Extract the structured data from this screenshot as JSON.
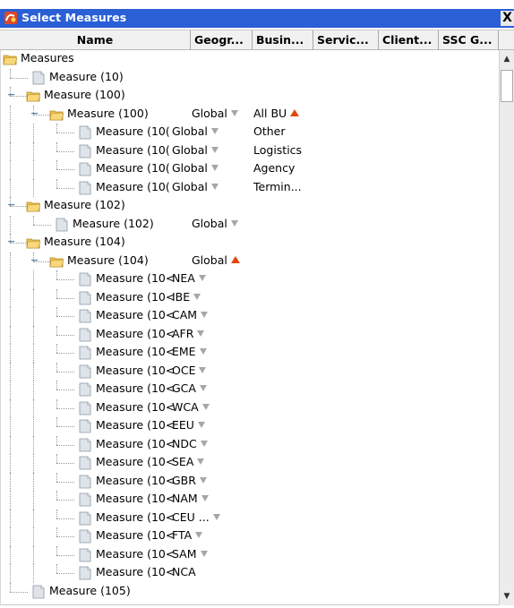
{
  "window": {
    "title": "Select Measures",
    "close_label": "X"
  },
  "columns": [
    "Name",
    "Geogr...",
    "Busin...",
    "Servic...",
    "Client...",
    "SSC G..."
  ],
  "rows": [
    {
      "level": 0,
      "type": "folder",
      "expanded": true,
      "label": "Measures",
      "geo": "",
      "geo_arrow": "",
      "bu": "",
      "bu_arrow": ""
    },
    {
      "level": 1,
      "type": "file",
      "expanded": false,
      "label": "Measure (10)",
      "geo": "",
      "geo_arrow": "",
      "bu": "",
      "bu_arrow": ""
    },
    {
      "level": 1,
      "type": "folder",
      "expanded": true,
      "label": "Measure (100)",
      "geo": "",
      "geo_arrow": "",
      "bu": "",
      "bu_arrow": ""
    },
    {
      "level": 2,
      "type": "folder",
      "expanded": true,
      "label": "Measure (100)",
      "geo": "Global",
      "geo_arrow": "down",
      "bu": "All BU",
      "bu_arrow": "up"
    },
    {
      "level": 3,
      "type": "file",
      "expanded": false,
      "label": "Measure (10(",
      "geo": "Global",
      "geo_arrow": "down",
      "bu": "Other",
      "bu_arrow": ""
    },
    {
      "level": 3,
      "type": "file",
      "expanded": false,
      "label": "Measure (10(",
      "geo": "Global",
      "geo_arrow": "down",
      "bu": "Logistics",
      "bu_arrow": ""
    },
    {
      "level": 3,
      "type": "file",
      "expanded": false,
      "label": "Measure (10(",
      "geo": "Global",
      "geo_arrow": "down",
      "bu": "Agency",
      "bu_arrow": ""
    },
    {
      "level": 3,
      "type": "file",
      "expanded": false,
      "label": "Measure (10(",
      "geo": "Global",
      "geo_arrow": "down",
      "bu": "Termin...",
      "bu_arrow": ""
    },
    {
      "level": 1,
      "type": "folder",
      "expanded": true,
      "label": "Measure (102)",
      "geo": "",
      "geo_arrow": "",
      "bu": "",
      "bu_arrow": ""
    },
    {
      "level": 2,
      "type": "file",
      "expanded": false,
      "label": "Measure (102)",
      "geo": "Global",
      "geo_arrow": "down",
      "bu": "",
      "bu_arrow": ""
    },
    {
      "level": 1,
      "type": "folder",
      "expanded": true,
      "label": "Measure (104)",
      "geo": "",
      "geo_arrow": "",
      "bu": "",
      "bu_arrow": ""
    },
    {
      "level": 2,
      "type": "folder",
      "expanded": true,
      "label": "Measure (104)",
      "geo": "Global",
      "geo_arrow": "up",
      "bu": "",
      "bu_arrow": ""
    },
    {
      "level": 3,
      "type": "file",
      "expanded": false,
      "label": "Measure (10<",
      "geo": "NEA",
      "geo_arrow": "down",
      "bu": "",
      "bu_arrow": ""
    },
    {
      "level": 3,
      "type": "file",
      "expanded": false,
      "label": "Measure (10<",
      "geo": "IBE",
      "geo_arrow": "down",
      "bu": "",
      "bu_arrow": ""
    },
    {
      "level": 3,
      "type": "file",
      "expanded": false,
      "label": "Measure (10<",
      "geo": "CAM",
      "geo_arrow": "down",
      "bu": "",
      "bu_arrow": ""
    },
    {
      "level": 3,
      "type": "file",
      "expanded": false,
      "label": "Measure (10<",
      "geo": "AFR",
      "geo_arrow": "down",
      "bu": "",
      "bu_arrow": ""
    },
    {
      "level": 3,
      "type": "file",
      "expanded": false,
      "label": "Measure (10<",
      "geo": "EME",
      "geo_arrow": "down",
      "bu": "",
      "bu_arrow": ""
    },
    {
      "level": 3,
      "type": "file",
      "expanded": false,
      "label": "Measure (10<",
      "geo": "OCE",
      "geo_arrow": "down",
      "bu": "",
      "bu_arrow": ""
    },
    {
      "level": 3,
      "type": "file",
      "expanded": false,
      "label": "Measure (10<",
      "geo": "GCA",
      "geo_arrow": "down",
      "bu": "",
      "bu_arrow": ""
    },
    {
      "level": 3,
      "type": "file",
      "expanded": false,
      "label": "Measure (10<",
      "geo": "WCA",
      "geo_arrow": "down",
      "bu": "",
      "bu_arrow": ""
    },
    {
      "level": 3,
      "type": "file",
      "expanded": false,
      "label": "Measure (10<",
      "geo": "EEU",
      "geo_arrow": "down",
      "bu": "",
      "bu_arrow": ""
    },
    {
      "level": 3,
      "type": "file",
      "expanded": false,
      "label": "Measure (10<",
      "geo": "NDC",
      "geo_arrow": "down",
      "bu": "",
      "bu_arrow": ""
    },
    {
      "level": 3,
      "type": "file",
      "expanded": false,
      "label": "Measure (10<",
      "geo": "SEA",
      "geo_arrow": "down",
      "bu": "",
      "bu_arrow": ""
    },
    {
      "level": 3,
      "type": "file",
      "expanded": false,
      "label": "Measure (10<",
      "geo": "GBR",
      "geo_arrow": "down",
      "bu": "",
      "bu_arrow": ""
    },
    {
      "level": 3,
      "type": "file",
      "expanded": false,
      "label": "Measure (10<",
      "geo": "NAM",
      "geo_arrow": "down",
      "bu": "",
      "bu_arrow": ""
    },
    {
      "level": 3,
      "type": "file",
      "expanded": false,
      "label": "Measure (10<",
      "geo": "CEU ...",
      "geo_arrow": "down",
      "bu": "",
      "bu_arrow": ""
    },
    {
      "level": 3,
      "type": "file",
      "expanded": false,
      "label": "Measure (10<",
      "geo": "FTA",
      "geo_arrow": "down",
      "bu": "",
      "bu_arrow": ""
    },
    {
      "level": 3,
      "type": "file",
      "expanded": false,
      "label": "Measure (10<",
      "geo": "SAM",
      "geo_arrow": "down",
      "bu": "",
      "bu_arrow": ""
    },
    {
      "level": 3,
      "type": "file",
      "expanded": false,
      "label": "Measure (10<",
      "geo": "NCA",
      "geo_arrow": "",
      "bu": "",
      "bu_arrow": ""
    },
    {
      "level": 1,
      "type": "file",
      "expanded": false,
      "label": "Measure (105)",
      "geo": "",
      "geo_arrow": "",
      "bu": "",
      "bu_arrow": ""
    }
  ],
  "colors": {
    "titlebar": "#2a5fd6",
    "arrow_down": "#a6a6a6",
    "arrow_up": "#e0480e",
    "folder": "#f2c14e",
    "file": "#dfe4ea"
  }
}
